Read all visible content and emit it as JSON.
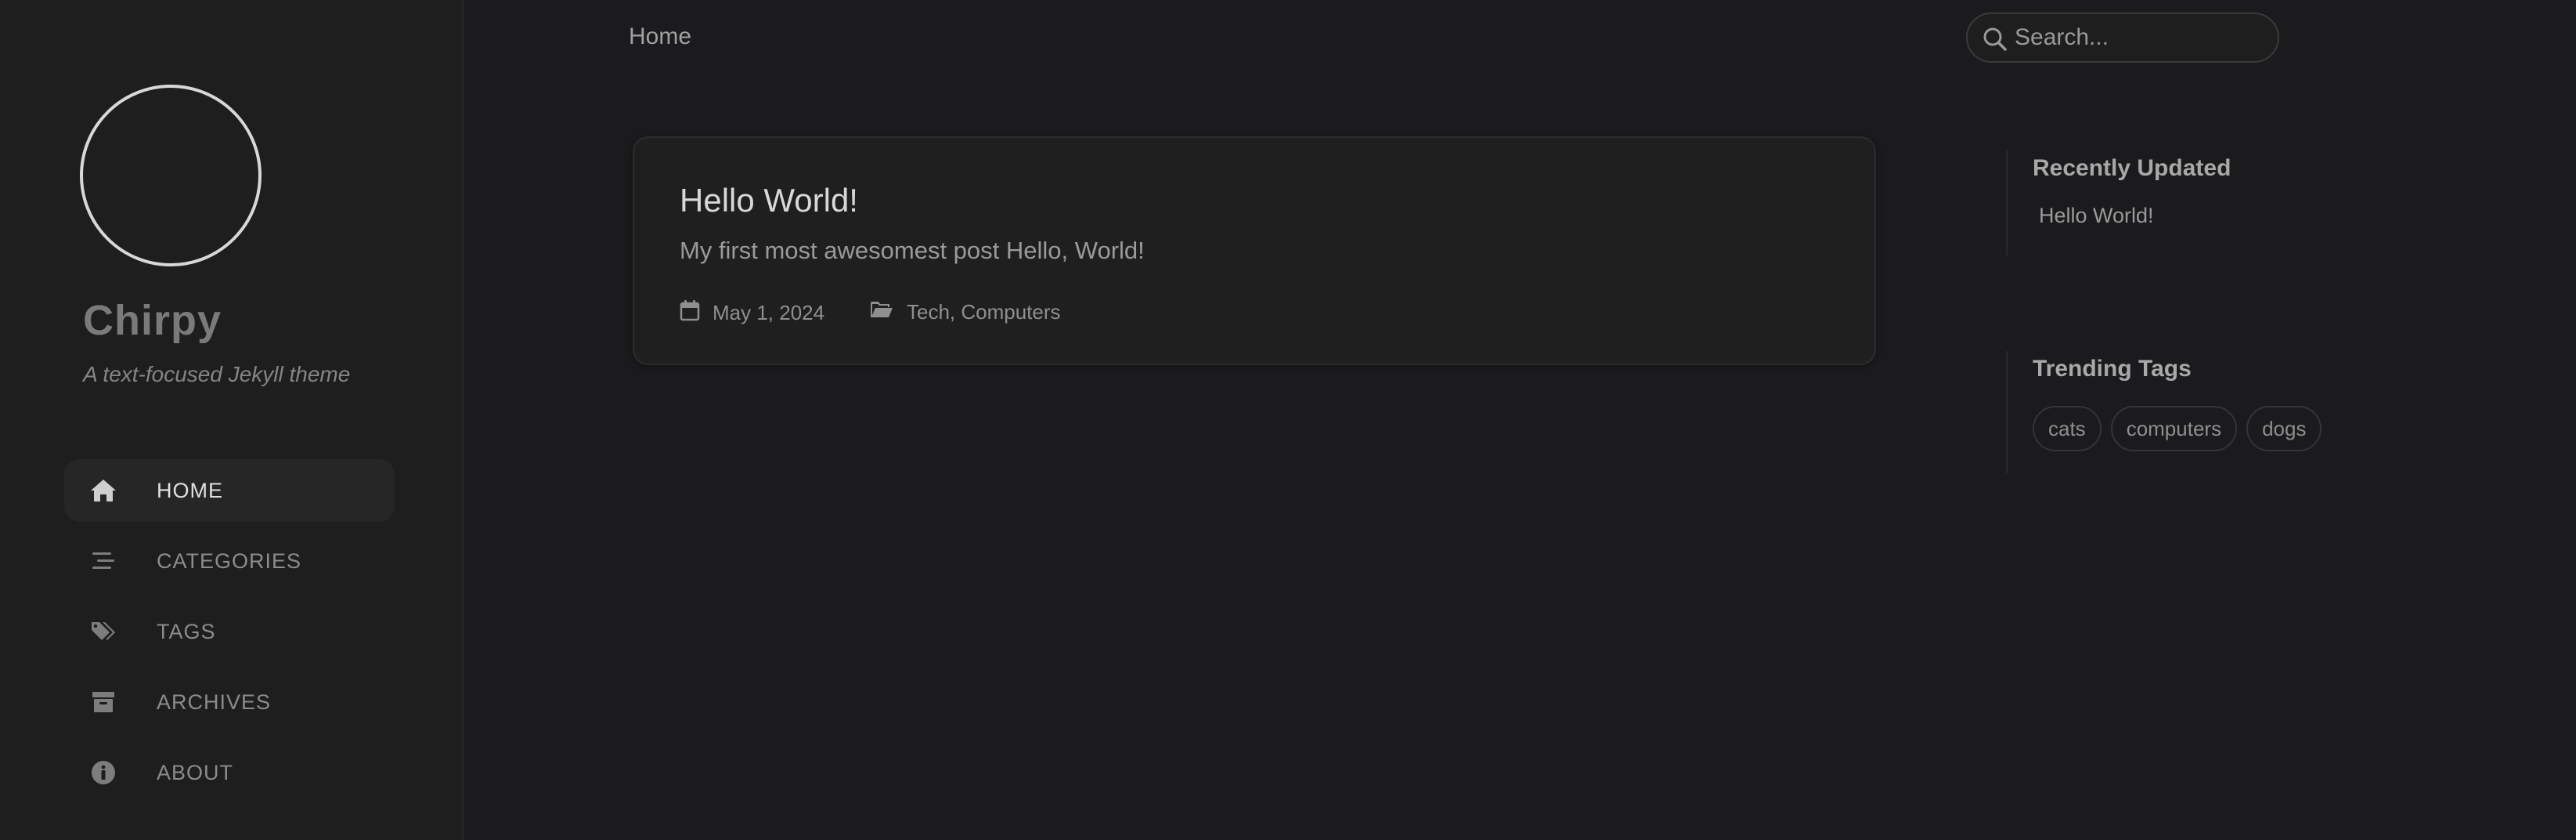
{
  "sidebar": {
    "title": "Chirpy",
    "subtitle": "A text-focused Jekyll theme",
    "nav": [
      {
        "label": "HOME",
        "icon": "home-icon",
        "active": true
      },
      {
        "label": "CATEGORIES",
        "icon": "stream-icon",
        "active": false
      },
      {
        "label": "TAGS",
        "icon": "tags-icon",
        "active": false
      },
      {
        "label": "ARCHIVES",
        "icon": "archive-icon",
        "active": false
      },
      {
        "label": "ABOUT",
        "icon": "info-circle-icon",
        "active": false
      }
    ]
  },
  "topbar": {
    "breadcrumb": "Home",
    "search_placeholder": "Search..."
  },
  "post": {
    "title": "Hello World!",
    "excerpt": "My first most awesomest post Hello, World!",
    "date": "May 1, 2024",
    "categories": "Tech, Computers"
  },
  "panel": {
    "recent_heading": "Recently Updated",
    "recent_items": [
      "Hello World!"
    ],
    "tags_heading": "Trending Tags",
    "tags": [
      "cats",
      "computers",
      "dogs"
    ]
  },
  "colors": {
    "background": "#1b1b1e",
    "sidebar_bg": "#1e1e1e",
    "card_bg": "#1f1f1f",
    "active_nav_bg": "#262626"
  }
}
